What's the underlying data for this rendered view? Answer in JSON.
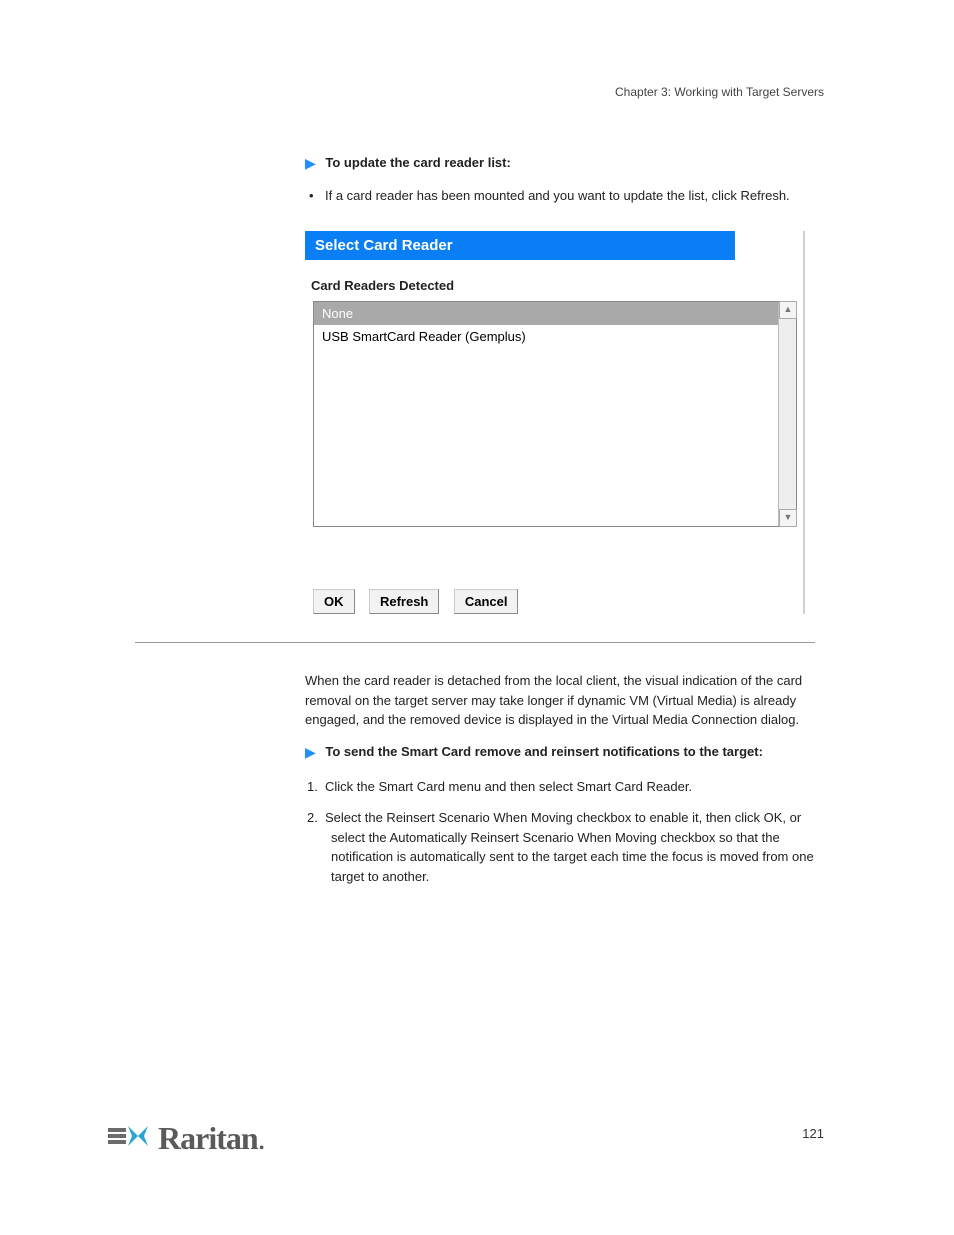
{
  "chapter": "Chapter 3: Working with Target Servers",
  "proc1": {
    "label": "To update the card reader list:"
  },
  "bullet1": "If a card reader has been mounted and you want to update the list, click Refresh.",
  "dialog": {
    "title": "Select Card Reader",
    "section": "Card Readers Detected",
    "items": {
      "none": "None",
      "dev": "USB SmartCard Reader (Gemplus)"
    },
    "buttons": {
      "ok": "OK",
      "refresh": "Refresh",
      "cancel": "Cancel"
    }
  },
  "para1": "When the card reader is detached from the local client, the visual indication of the card removal on the target server may take longer if dynamic VM (Virtual Media) is already engaged, and the removed device is displayed in the Virtual Media Connection dialog.",
  "proc2": {
    "label": "To send the Smart Card remove and reinsert notifications to the target:"
  },
  "steps": {
    "s1": "Click the Smart Card menu and then select Smart Card Reader.",
    "s2": "Select the Reinsert Scenario When Moving checkbox to enable it, then click OK, or select the Automatically Reinsert Scenario When Moving checkbox so that the notification is automatically sent to the target each time the focus is moved from one target to another."
  },
  "page_number": "121"
}
